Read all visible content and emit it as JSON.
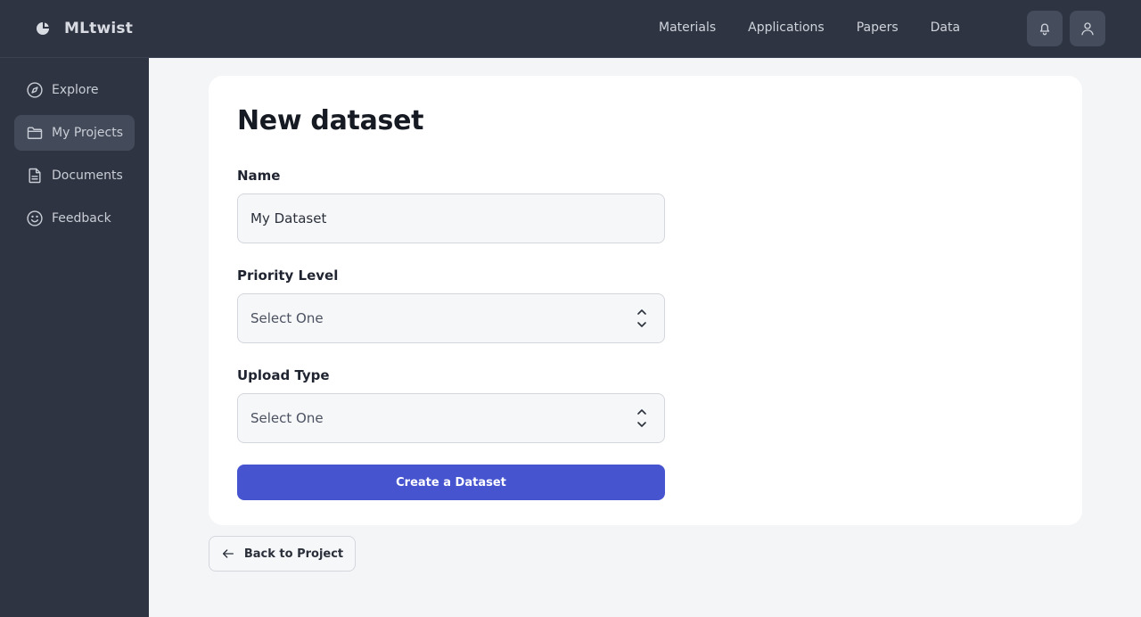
{
  "app": {
    "name": "MLtwist"
  },
  "topnav": {
    "items": [
      {
        "label": "Materials"
      },
      {
        "label": "Applications"
      },
      {
        "label": "Papers"
      },
      {
        "label": "Data"
      }
    ]
  },
  "header_icons": [
    "bell-icon",
    "user-icon"
  ],
  "sidebar": {
    "items": [
      {
        "label": "Explore",
        "icon": "compass-icon",
        "active": false
      },
      {
        "label": "My Projects",
        "icon": "folder-icon",
        "active": true
      },
      {
        "label": "Documents",
        "icon": "document-icon",
        "active": false
      },
      {
        "label": "Feedback",
        "icon": "smiley-icon",
        "active": false
      }
    ]
  },
  "form": {
    "title": "New dataset",
    "name": {
      "label": "Name",
      "value": "My Dataset"
    },
    "priority": {
      "label": "Priority Level",
      "value": "Select One"
    },
    "upload_type": {
      "label": "Upload Type",
      "value": "Select One"
    },
    "submit_label": "Create a Dataset"
  },
  "back_label": "Back to Project",
  "colors": {
    "topbar": "#2e3441",
    "sidebar": "#2e3441",
    "accent": "#4654cf",
    "page_bg": "#f4f5f7"
  }
}
